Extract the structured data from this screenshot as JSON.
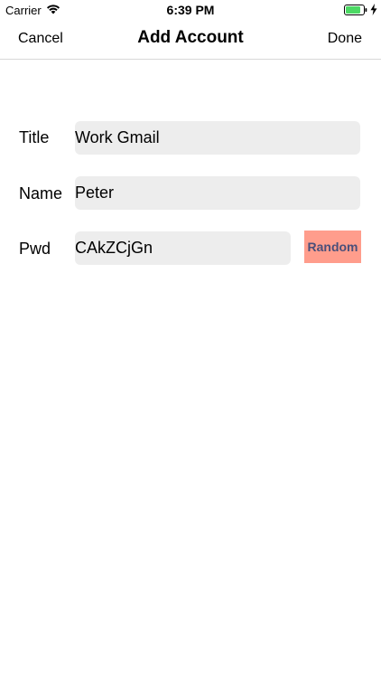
{
  "status_bar": {
    "carrier": "Carrier",
    "time": "6:39 PM",
    "battery_color": "#4cd964"
  },
  "nav": {
    "cancel_label": "Cancel",
    "title": "Add Account",
    "done_label": "Done"
  },
  "form": {
    "title_label": "Title",
    "title_value": "Work Gmail",
    "name_label": "Name",
    "name_value": "Peter",
    "pwd_label": "Pwd",
    "pwd_value": "CAkZCjGn",
    "random_label": "Random",
    "field_bg": "#ededed",
    "random_bg": "#ff9d8c",
    "random_text_color": "#4a4f7a"
  }
}
